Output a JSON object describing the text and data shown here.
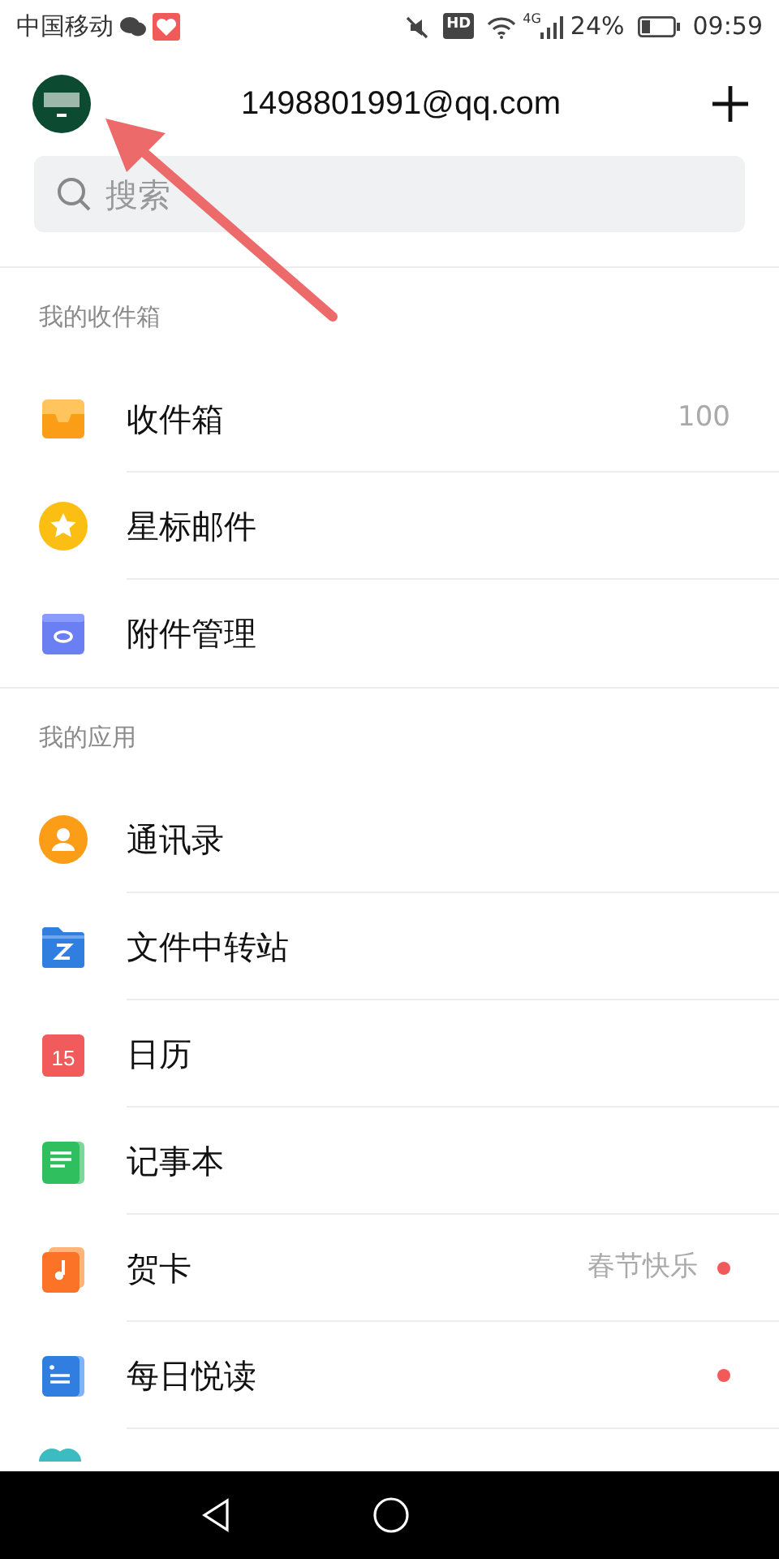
{
  "status_bar": {
    "carrier": "中国移动",
    "hd": "HD",
    "network": "4G",
    "battery": "24%",
    "time": "09:59"
  },
  "header": {
    "account": "1498801991@qq.com"
  },
  "search": {
    "placeholder": "搜索"
  },
  "sections": [
    {
      "title": "我的收件箱",
      "items": [
        {
          "kind": "inbox",
          "label": "收件箱",
          "count": "100",
          "dot": false
        },
        {
          "kind": "star",
          "label": "星标邮件",
          "dot": false
        },
        {
          "kind": "attachment",
          "label": "附件管理",
          "dot": false
        }
      ]
    },
    {
      "title": "我的应用",
      "items": [
        {
          "kind": "contacts",
          "label": "通讯录",
          "dot": false
        },
        {
          "kind": "transfer",
          "label": "文件中转站",
          "dot": false
        },
        {
          "kind": "calendar",
          "label": "日历",
          "icon_text": "15",
          "dot": false
        },
        {
          "kind": "notes",
          "label": "记事本",
          "dot": false
        },
        {
          "kind": "card",
          "label": "贺卡",
          "note": "春节快乐",
          "dot": true
        },
        {
          "kind": "reading",
          "label": "每日悦读",
          "dot": true
        },
        {
          "kind": "partial"
        }
      ]
    }
  ]
}
